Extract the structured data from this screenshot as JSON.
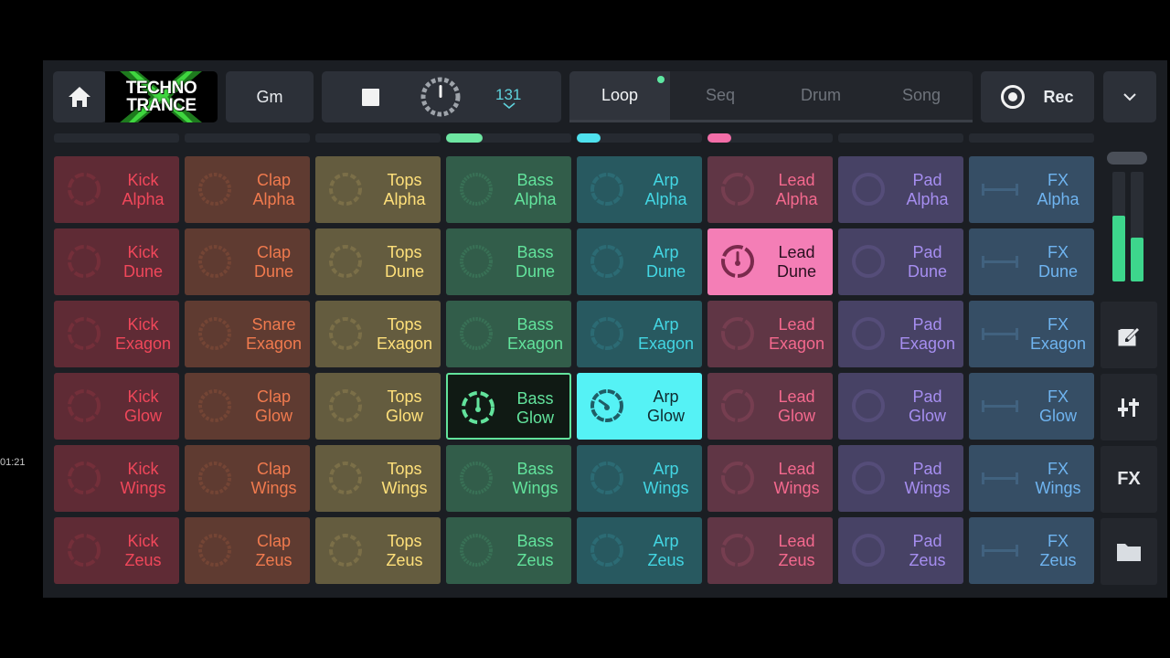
{
  "header": {
    "logo_line1": "TECHNO",
    "logo_line2": "TRANCE",
    "key": "Gm",
    "tempo": "131",
    "modes": [
      {
        "label": "Loop",
        "active": true
      },
      {
        "label": "Seq",
        "active": false
      },
      {
        "label": "Drum",
        "active": false
      },
      {
        "label": "Song",
        "active": false
      }
    ],
    "rec_label": "Rec"
  },
  "colors": {
    "kick": "#f0475a",
    "clap": "#f07a4e",
    "tops": "#ffe07a",
    "bass": "#62e39c",
    "arp": "#43d6e3",
    "lead": "#f4698e",
    "pad": "#a68ef0",
    "fx": "#6fb4f0",
    "playing_lead": "#f47eb6",
    "playing_arp": "#55f2f5"
  },
  "columns": [
    {
      "id": "kick",
      "indicator": null
    },
    {
      "id": "clap",
      "indicator": null
    },
    {
      "id": "tops",
      "indicator": null
    },
    {
      "id": "bass",
      "indicator": "#6ee6a2"
    },
    {
      "id": "arp",
      "indicator": "#4fe2ee"
    },
    {
      "id": "lead",
      "indicator": "#f36ea8"
    },
    {
      "id": "pad",
      "indicator": null
    },
    {
      "id": "fx",
      "indicator": null
    }
  ],
  "pads": [
    [
      "Kick|Alpha",
      "Clap|Alpha",
      "Tops|Alpha",
      "Bass|Alpha",
      "Arp|Alpha",
      "Lead|Alpha",
      "Pad|Alpha",
      "FX|Alpha"
    ],
    [
      "Kick|Dune",
      "Clap|Dune",
      "Tops|Dune",
      "Bass|Dune",
      "Arp|Dune",
      "Lead|Dune",
      "Pad|Dune",
      "FX|Dune"
    ],
    [
      "Kick|Exagon",
      "Snare|Exagon",
      "Tops|Exagon",
      "Bass|Exagon",
      "Arp|Exagon",
      "Lead|Exagon",
      "Pad|Exagon",
      "FX|Exagon"
    ],
    [
      "Kick|Glow",
      "Clap|Glow",
      "Tops|Glow",
      "Bass|Glow",
      "Arp|Glow",
      "Lead|Glow",
      "Pad|Glow",
      "FX|Glow"
    ],
    [
      "Kick|Wings",
      "Clap|Wings",
      "Tops|Wings",
      "Bass|Wings",
      "Arp|Wings",
      "Lead|Wings",
      "Pad|Wings",
      "FX|Wings"
    ],
    [
      "Kick|Zeus",
      "Clap|Zeus",
      "Tops|Zeus",
      "Bass|Zeus",
      "Arp|Zeus",
      "Lead|Zeus",
      "Pad|Zeus",
      "FX|Zeus"
    ]
  ],
  "states": {
    "1,5": "playing",
    "3,3": "queued",
    "3,4": "playing"
  },
  "sidebar": {
    "fx_label": "FX",
    "meter_levels": [
      0.6,
      0.4
    ],
    "icons": [
      "edit-icon",
      "mixer-sliders-icon",
      "fx-button",
      "folder-icon"
    ]
  },
  "overlay_timestamp": "01:21"
}
